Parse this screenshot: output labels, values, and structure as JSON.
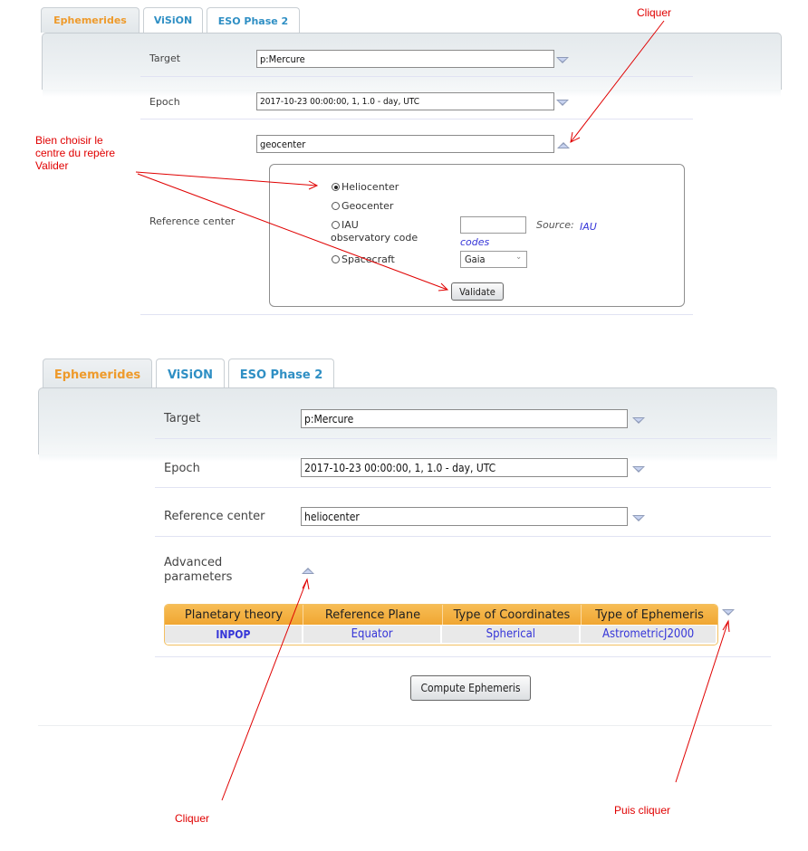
{
  "tabs": [
    {
      "label": "Ephemerides",
      "active": true
    },
    {
      "label": "ViSiON",
      "active": false
    },
    {
      "label": "ESO Phase 2",
      "active": false
    }
  ],
  "screen1": {
    "target": {
      "label": "Target",
      "value": "p:Mercure"
    },
    "epoch": {
      "label": "Epoch",
      "value": "2017-10-23 00:00:00, 1, 1.0 - day, UTC"
    },
    "reference_center": {
      "label": "Reference center",
      "value": "geocenter",
      "options": [
        {
          "label": "Heliocenter",
          "checked": true
        },
        {
          "label": "Geocenter",
          "checked": false
        },
        {
          "label": "IAU observatory code",
          "checked": false
        },
        {
          "label": "Spacecraft",
          "checked": false
        }
      ],
      "iau_code_value": "",
      "source_prefix": "Source:",
      "source_link": "IAU codes",
      "spacecraft_selected": "Gaia",
      "validate_label": "Validate"
    }
  },
  "screen2": {
    "target": {
      "label": "Target",
      "value": "p:Mercure"
    },
    "epoch": {
      "label": "Epoch",
      "value": "2017-10-23 00:00:00, 1, 1.0 - day, UTC"
    },
    "reference_center": {
      "label": "Reference center",
      "value": "heliocenter"
    },
    "advanced": {
      "label": "Advanced parameters",
      "columns": [
        "Planetary theory",
        "Reference Plane",
        "Type of Coordinates",
        "Type of Ephemeris"
      ],
      "values": [
        "INPOP",
        "Equator",
        "Spherical",
        "AstrometricJ2000"
      ]
    },
    "compute_label": "Compute Ephemeris"
  },
  "annotations": {
    "top_click": "Cliquer",
    "choose_center": [
      "Bien choisir le",
      "centre du repère",
      "Valider"
    ],
    "bottom_click": "Cliquer",
    "then_click": "Puis cliquer"
  },
  "colors": {
    "active_tab": "#ee9a2b",
    "inactive_tab": "#2f8fc4",
    "annotation": "#e00000",
    "table_header": "#f0a632",
    "table_value": "#3535d8"
  }
}
